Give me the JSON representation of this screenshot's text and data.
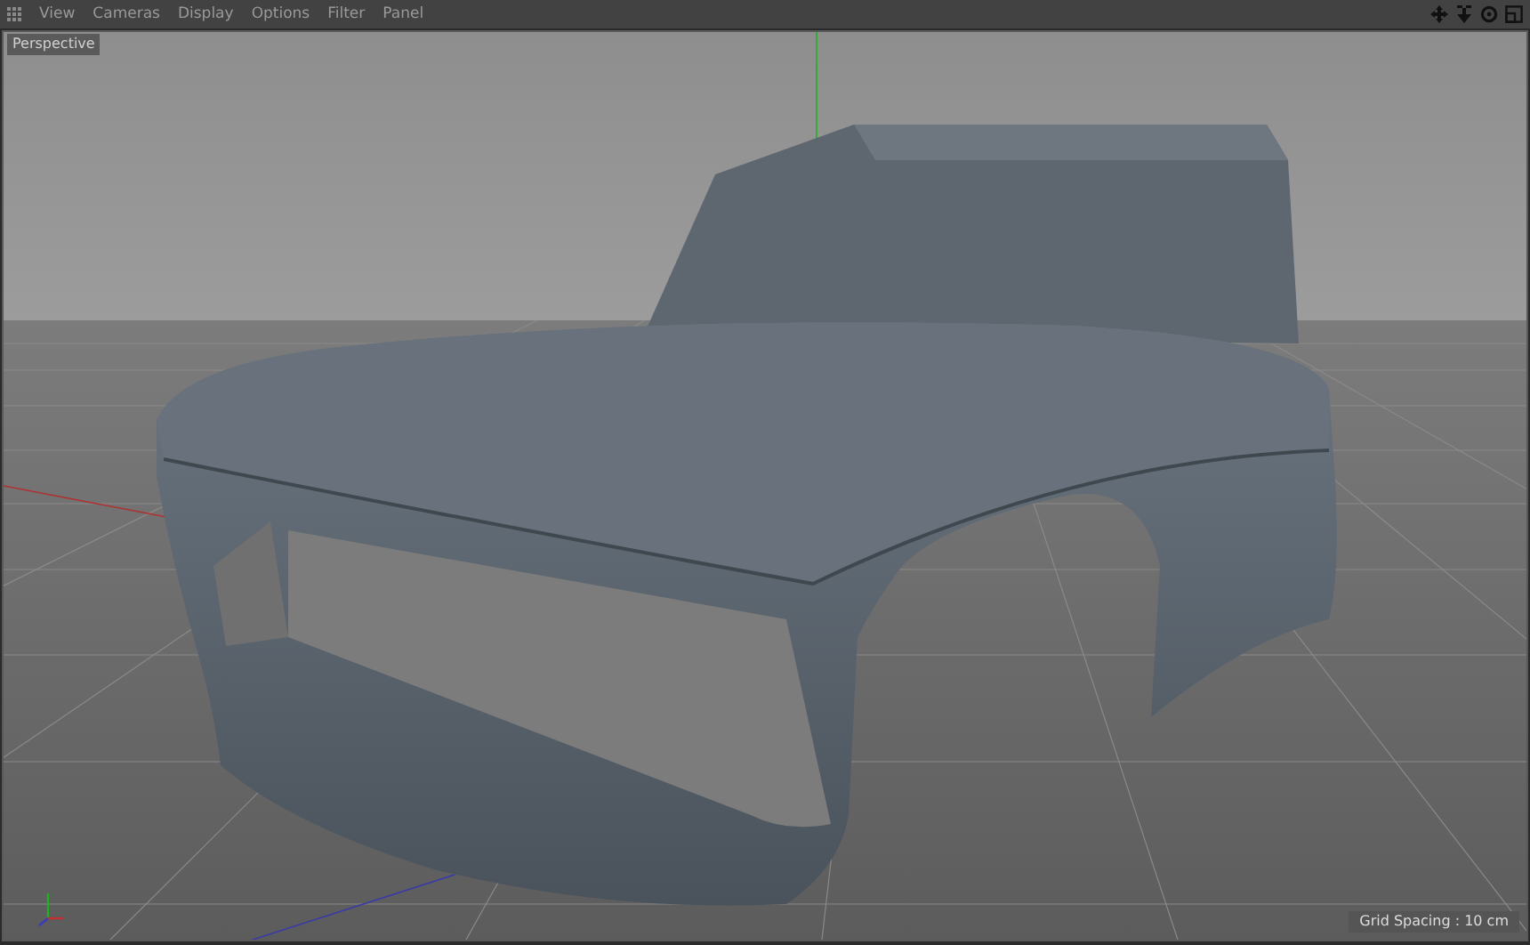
{
  "menu_bar": {
    "items": [
      "View",
      "Cameras",
      "Display",
      "Options",
      "Filter",
      "Panel"
    ]
  },
  "viewport": {
    "camera_label": "Perspective",
    "grid_spacing": "Grid Spacing : 10 cm"
  }
}
